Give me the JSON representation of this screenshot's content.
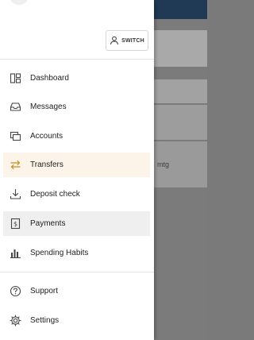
{
  "background": {
    "partial_text": "mtg"
  },
  "header": {
    "switch_label": "SWITCH"
  },
  "menu": {
    "items": [
      {
        "label": "Dashboard",
        "icon": "dashboard-icon"
      },
      {
        "label": "Messages",
        "icon": "inbox-icon"
      },
      {
        "label": "Accounts",
        "icon": "accounts-icon"
      },
      {
        "label": "Transfers",
        "icon": "transfer-arrows-icon"
      },
      {
        "label": "Deposit check",
        "icon": "download-tray-icon"
      },
      {
        "label": "Payments",
        "icon": "dollar-document-icon"
      },
      {
        "label": "Spending Habits",
        "icon": "bar-chart-icon"
      }
    ],
    "secondary": [
      {
        "label": "Support",
        "icon": "help-circle-icon"
      },
      {
        "label": "Settings",
        "icon": "gear-icon"
      }
    ]
  },
  "colors": {
    "drawer_bg": "#ffffff",
    "highlight_transfers": "#fdf4e9",
    "highlight_payments": "#efefef",
    "transfer_icon": "#c98a1e",
    "topbar": "#203a55"
  }
}
